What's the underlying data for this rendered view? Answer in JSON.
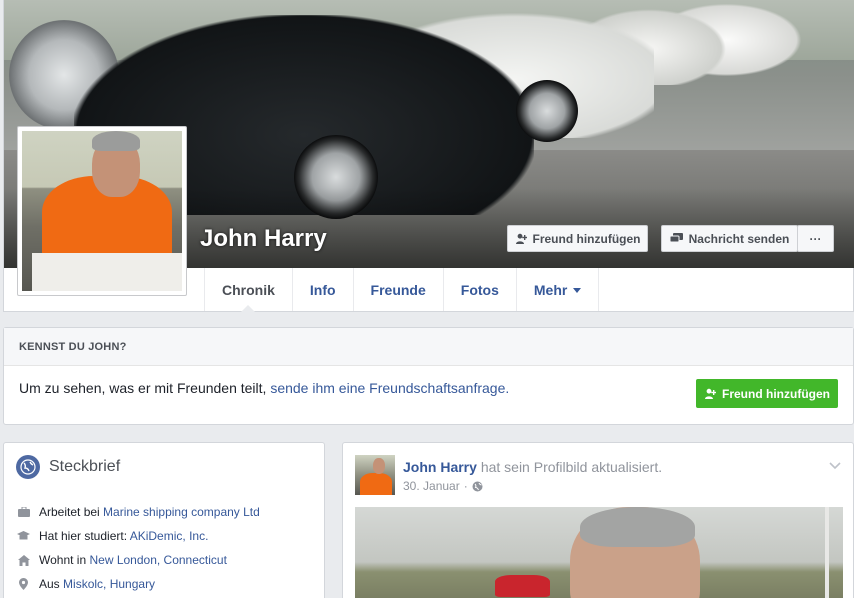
{
  "profile": {
    "name": "John Harry",
    "add_friend_label": "Freund hinzufügen",
    "message_label": "Nachricht senden",
    "more_label": "···"
  },
  "tabs": [
    {
      "label": "Chronik",
      "active": true
    },
    {
      "label": "Info",
      "active": false
    },
    {
      "label": "Freunde",
      "active": false
    },
    {
      "label": "Fotos",
      "active": false
    },
    {
      "label": "Mehr",
      "active": false,
      "has_caret": true
    }
  ],
  "know": {
    "title": "KENNST DU JOHN?",
    "text": "Um zu sehen, was er mit Freunden teilt,",
    "link": "sende ihm eine Freundschaftsanfrage.",
    "button_label": "Freund hinzufügen"
  },
  "intro": {
    "title": "Steckbrief",
    "items": [
      {
        "icon": "briefcase-icon",
        "prefix": "Arbeitet bei",
        "link": "Marine shipping company Ltd"
      },
      {
        "icon": "graduation-cap-icon",
        "prefix": "Hat hier studiert:",
        "link": "AKiDemic, Inc."
      },
      {
        "icon": "home-icon",
        "prefix": "Wohnt in",
        "link": "New London, Connecticut"
      },
      {
        "icon": "location-pin-icon",
        "prefix": "Aus",
        "link": "Miskolc, Hungary"
      }
    ]
  },
  "post": {
    "author": "John Harry",
    "action": "hat sein Profilbild aktualisiert.",
    "date": "30. Januar",
    "separator": "·"
  },
  "colors": {
    "link": "#365899",
    "green_button": "#42b72a",
    "page_background": "#e9ebee",
    "globe": "#4e69a2"
  }
}
